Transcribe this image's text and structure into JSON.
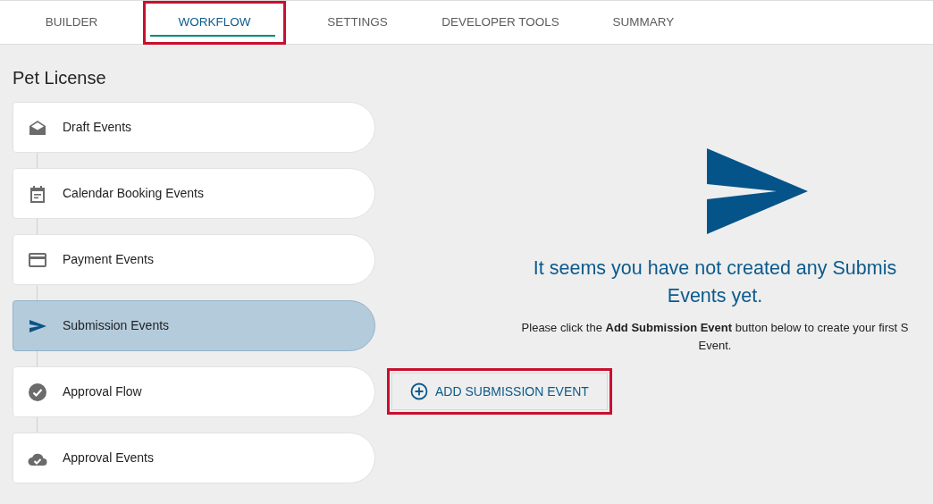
{
  "tabs": [
    {
      "label": "BUILDER",
      "selected": false,
      "highlighted": false
    },
    {
      "label": "WORKFLOW",
      "selected": true,
      "highlighted": true
    },
    {
      "label": "SETTINGS",
      "selected": false,
      "highlighted": false
    },
    {
      "label": "DEVELOPER TOOLS",
      "selected": false,
      "highlighted": false
    },
    {
      "label": "SUMMARY",
      "selected": false,
      "highlighted": false
    }
  ],
  "title": "Pet License",
  "event_types": [
    {
      "label": "Draft Events",
      "kind": "draft",
      "selected": false
    },
    {
      "label": "Calendar Booking Events",
      "kind": "calendar",
      "selected": false
    },
    {
      "label": "Payment Events",
      "kind": "payment",
      "selected": false
    },
    {
      "label": "Submission Events",
      "kind": "submission",
      "selected": true
    },
    {
      "label": "Approval Flow",
      "kind": "approval_flow",
      "selected": false
    },
    {
      "label": "Approval Events",
      "kind": "approval",
      "selected": false
    }
  ],
  "empty_state": {
    "heading": "It seems you have not created any Submis\nEvents yet.",
    "message": "Please click the **Add Submission Event** button below to create your first S\nEvent."
  },
  "add_button": {
    "label": "ADD SUBMISSION EVENT",
    "highlighted": true
  }
}
